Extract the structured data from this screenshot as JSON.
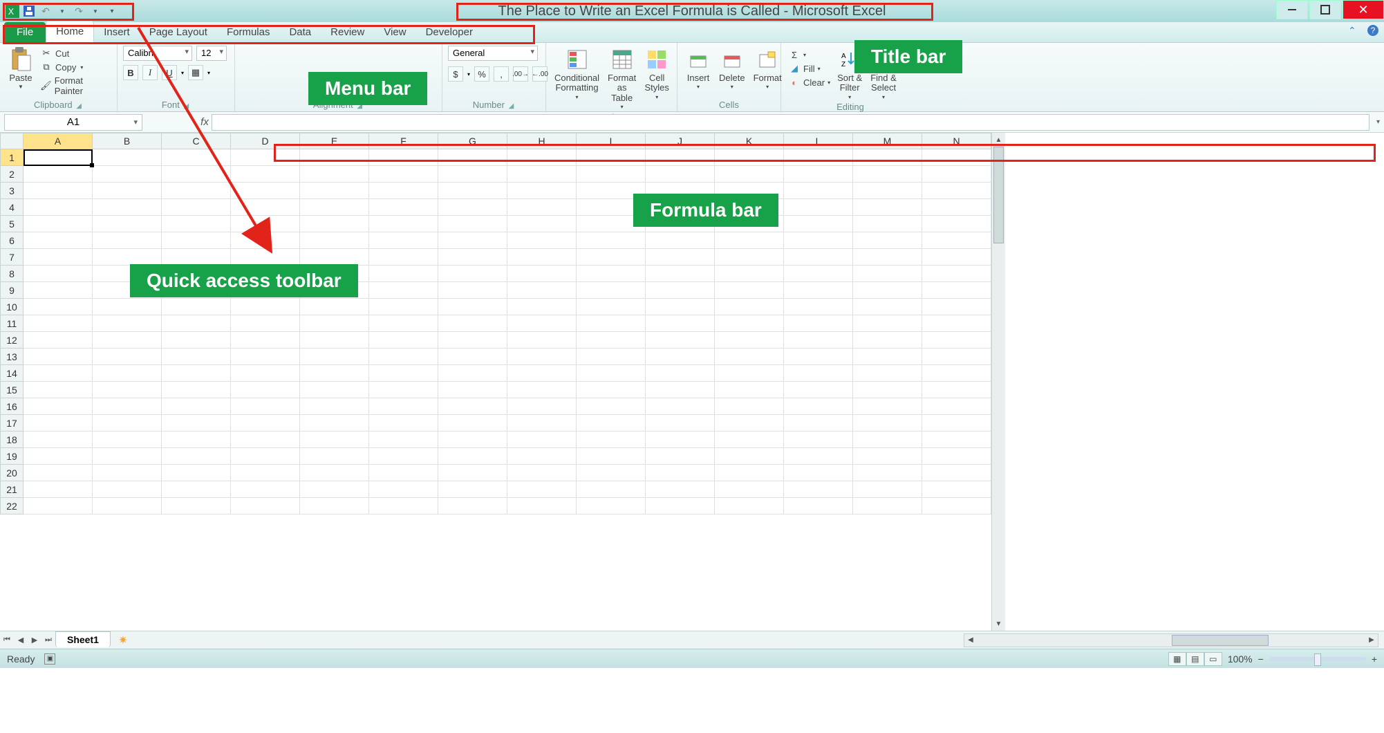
{
  "title": "The Place to Write an Excel Formula is Called - Microsoft Excel",
  "qat": {
    "undo": "↶",
    "redo": "↷"
  },
  "tabs": [
    "File",
    "Home",
    "Insert",
    "Page Layout",
    "Formulas",
    "Data",
    "Review",
    "View",
    "Developer"
  ],
  "ribbon": {
    "clipboard": {
      "label": "Clipboard",
      "paste": "Paste",
      "cut": "Cut",
      "copy": "Copy",
      "format_painter": "Format Painter"
    },
    "font": {
      "label": "Font",
      "name": "Calibri",
      "size": "12"
    },
    "alignment": {
      "label": "Alignment"
    },
    "number": {
      "label": "Number",
      "format": "General"
    },
    "styles": {
      "label": "Styles",
      "cond": "Conditional\nFormatting",
      "table": "Format\nas Table",
      "cell": "Cell\nStyles"
    },
    "cells": {
      "label": "Cells",
      "insert": "Insert",
      "delete": "Delete",
      "format": "Format"
    },
    "editing": {
      "label": "Editing",
      "fill": "Fill",
      "clear": "Clear",
      "sort": "Sort &\nFilter",
      "find": "Find &\nSelect"
    }
  },
  "name_box": "A1",
  "columns": [
    "A",
    "B",
    "C",
    "D",
    "E",
    "F",
    "G",
    "H",
    "I",
    "J",
    "K",
    "L",
    "M",
    "N"
  ],
  "row_count": 22,
  "sheet_tab": "Sheet1",
  "status_text": "Ready",
  "zoom": "100%",
  "callouts": {
    "title_bar": "Title bar",
    "menu_bar": "Menu bar",
    "formula_bar": "Formula bar",
    "qat": "Quick access toolbar"
  }
}
